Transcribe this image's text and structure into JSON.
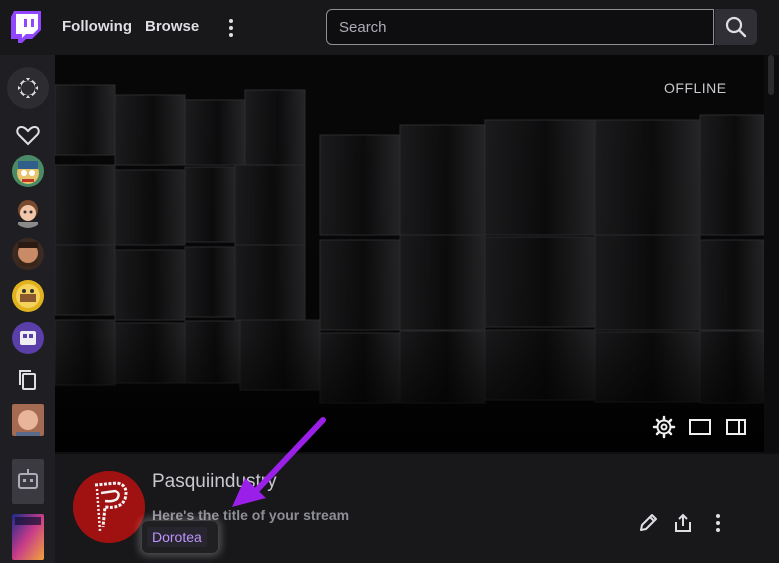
{
  "topbar": {
    "logo_icon": "twitch-glitch-icon",
    "nav": [
      {
        "label": "Following"
      },
      {
        "label": "Browse"
      }
    ],
    "more_icon": "more-vertical-icon",
    "search": {
      "placeholder": "Search",
      "value": ""
    },
    "search_icon": "search-icon"
  },
  "sidebar": {
    "items": [
      {
        "icon": "collapse-arrows-icon"
      },
      {
        "icon": "heart-icon"
      },
      {
        "icon": "avatar"
      },
      {
        "icon": "avatar"
      },
      {
        "icon": "avatar"
      },
      {
        "icon": "avatar"
      },
      {
        "icon": "avatar"
      },
      {
        "icon": "copy-icon"
      },
      {
        "icon": "thumbnail"
      },
      {
        "icon": "robot-icon"
      },
      {
        "icon": "thumbnail"
      }
    ]
  },
  "player": {
    "status": "OFFLINE",
    "controls": [
      "settings-icon",
      "theatre-mode-icon",
      "sidebar-toggle-icon"
    ]
  },
  "channel": {
    "name": "Pasquiindustry",
    "stream_title": "Here's the title of your stream",
    "category": "Dorotea",
    "actions": [
      "edit-icon",
      "share-icon",
      "more-vertical-icon"
    ]
  },
  "colors": {
    "brand": "#9147ff",
    "accent_link": "#bf94ff",
    "annotation_arrow": "#9a1fe8",
    "avatar_bg": "#a01111"
  }
}
